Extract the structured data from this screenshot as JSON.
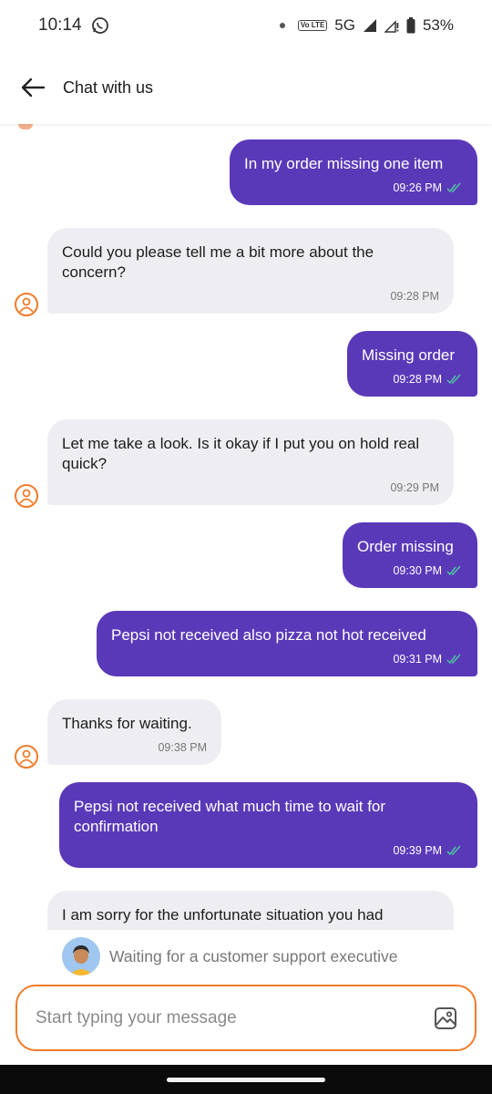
{
  "status_bar": {
    "time": "10:14",
    "network": "5G",
    "battery": "53%",
    "volte_badge": "Vo LTE"
  },
  "header": {
    "title": "Chat with us"
  },
  "messages": [
    {
      "from": "user",
      "text": "In my order missing one item",
      "time": "09:26 PM"
    },
    {
      "from": "agent",
      "text": "Could you please tell me a bit more about the concern?",
      "time": "09:28 PM"
    },
    {
      "from": "user",
      "text": "Missing order",
      "time": "09:28 PM"
    },
    {
      "from": "agent",
      "text": "Let me take a look. Is it okay if I put you on hold real quick?",
      "time": "09:29 PM"
    },
    {
      "from": "user",
      "text": "Order missing",
      "time": "09:30 PM"
    },
    {
      "from": "user",
      "text": "Pepsi not received also pizza not hot received",
      "time": "09:31 PM"
    },
    {
      "from": "agent",
      "text": "Thanks for waiting.",
      "time": "09:38 PM"
    },
    {
      "from": "user",
      "text": "Pepsi not received what much time to wait for confirmation",
      "time": "09:39 PM"
    },
    {
      "from": "agent",
      "text": "I am sorry for the unfortunate situation you had",
      "time": ""
    }
  ],
  "waiting_banner": {
    "text": "Waiting for a customer support executive"
  },
  "composer": {
    "placeholder": "Start typing your message",
    "value": ""
  },
  "colors": {
    "outgoing_bubble": "#5a39b8",
    "incoming_bubble": "#eeeef2",
    "accent": "#f07b2a",
    "read_ticks": "#4fc3a1"
  },
  "icons": {
    "back": "arrow-left-icon",
    "whatsapp": "whatsapp-icon",
    "signal": "signal-icon",
    "battery": "battery-icon",
    "agent_avatar": "user-avatar-icon",
    "image_attach": "image-icon"
  }
}
